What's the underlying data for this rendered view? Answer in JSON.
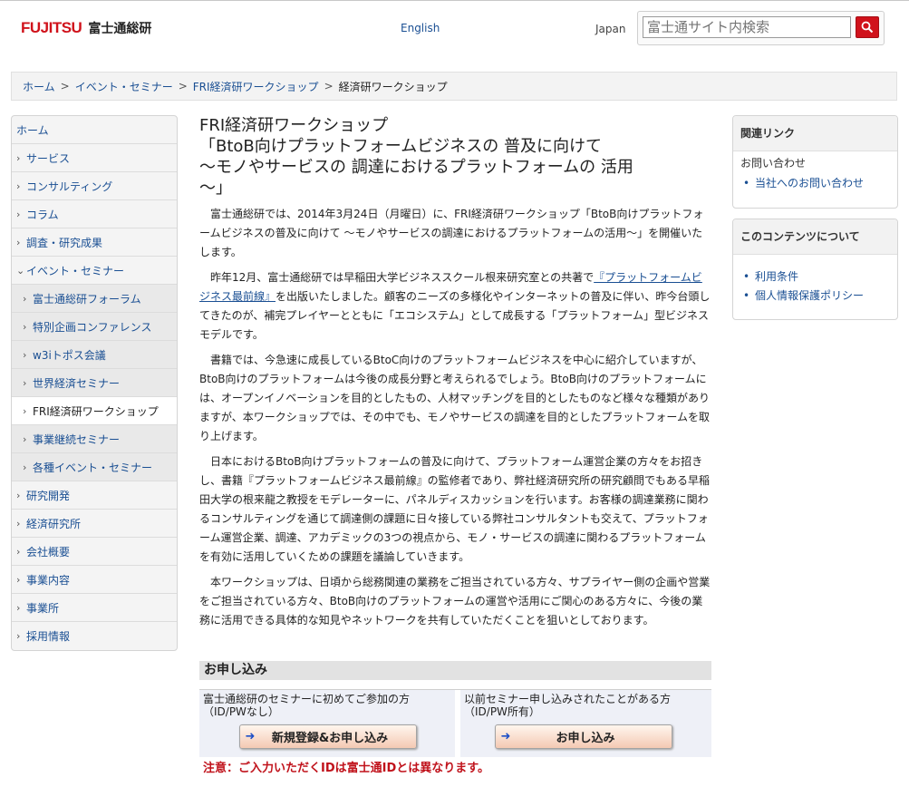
{
  "header": {
    "brand": "FUJITSU",
    "brand_jp": "富士通総研",
    "lang_link": "English",
    "region": "Japan",
    "search_placeholder": "富士通サイト内検索",
    "search_button_icon": "search-icon"
  },
  "breadcrumb": {
    "items": [
      "ホーム",
      "イベント・セミナー",
      "FRI経済研ワークショップ"
    ],
    "current": "経済研ワークショップ"
  },
  "leftnav": {
    "home": "ホーム",
    "items": [
      "サービス",
      "コンサルティング",
      "コラム",
      "調査・研究成果",
      "イベント・セミナー"
    ],
    "sub_items": [
      "富士通総研フォーラム",
      "特別企画コンファレンス",
      "w3iトポス会議",
      "世界経済セミナー",
      "FRI経済研ワークショップ",
      "事業継続セミナー",
      "各種イベント・セミナー"
    ],
    "items_after": [
      "研究開発",
      "経済研究所",
      "会社概要",
      "事業内容",
      "事業所",
      "採用情報"
    ]
  },
  "main": {
    "title_line1": "FRI経済研ワークショップ",
    "title_line2": "「BtoB向けプラットフォームビジネスの 普及に向けて",
    "title_line3": "～モノやサービスの 調達におけるプラットフォームの 活用",
    "title_line4": "～」",
    "p1": "富士通総研では、2014年3月24日（月曜日）に、FRI経済研ワークショップ「BtoB向けプラットフォームビジネスの普及に向けて ～モノやサービスの調達におけるプラットフォームの活用～」を開催いたします。",
    "p2_a": "昨年12月、富士通総研では早稲田大学ビジネススクール根来研究室との共著で",
    "p2_link": "『プラットフォームビジネス最前線』",
    "p2_b": "を出版いたしました。顧客のニーズの多様化やインターネットの普及に伴い、昨今台頭してきたのが、補完プレイヤーとともに「エコシステム」として成長する「プラットフォーム」型ビジネスモデルです。",
    "p3": "書籍では、今急速に成長しているBtoC向けのプラットフォームビジネスを中心に紹介していますが、BtoB向けのプラットフォームは今後の成長分野と考えられるでしょう。BtoB向けのプラットフォームには、オープンイノベーションを目的としたもの、人材マッチングを目的としたものなど様々な種類がありますが、本ワークショップでは、その中でも、モノやサービスの調達を目的としたプラットフォームを取り上げます。",
    "p4": "日本におけるBtoB向けプラットフォームの普及に向けて、プラットフォーム運営企業の方々をお招きし、書籍『プラットフォームビジネス最前線』の監修者であり、弊社経済研究所の研究顧問でもある早稲田大学の根来龍之教授をモデレーターに、パネルディスカッションを行います。お客様の調達業務に関わるコンサルティングを通じて調達側の課題に日々接している弊社コンサルタントも交えて、プラットフォーム運営企業、調達、アカデミックの3つの視点から、モノ・サービスの調達に関わるプラットフォームを有効に活用していくための課題を議論していきます。",
    "p5": "本ワークショップは、日頃から総務関連の業務をご担当されている方々、サプライヤー側の企画や営業をご担当されている方々、BtoB向けのプラットフォームの運営や活用にご関心のある方々に、今後の業務に活用できる具体的な知見やネットワークを共有していただくことを狙いとしております。"
  },
  "application": {
    "heading": "お申し込み",
    "new_label": "富士通総研のセミナーに初めてご参加の方（ID/PWなし）",
    "new_button": "新規登録&お申し込み",
    "existing_label": "以前セミナー申し込みされたことがある方（ID/PW所有）",
    "existing_button": "お申し込み",
    "note": "注意：ご入力いただくIDは富士通IDとは異なります。"
  },
  "sidebar_right": {
    "related_head": "関連リンク",
    "related_sub": "お問い合わせ",
    "related_links": [
      "当社へのお問い合わせ"
    ],
    "about_head": "このコンテンツについて",
    "about_links": [
      "利用条件",
      "個人情報保護ポリシー"
    ]
  }
}
